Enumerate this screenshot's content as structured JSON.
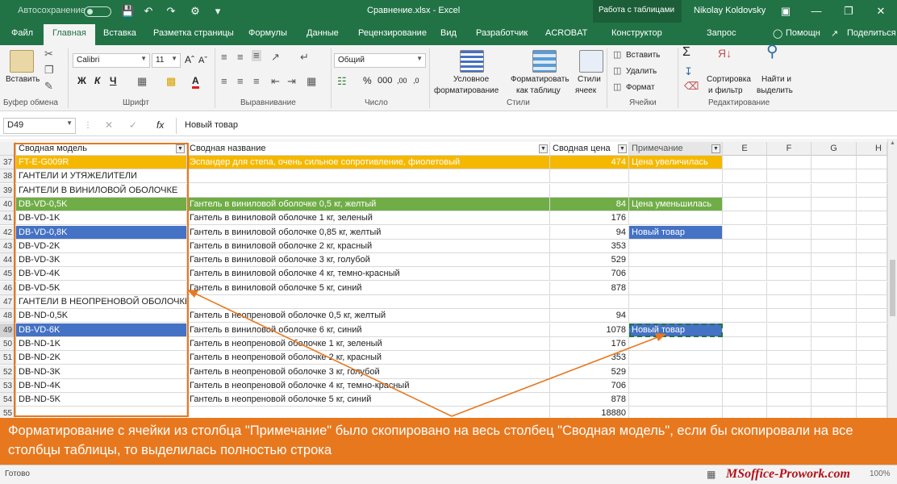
{
  "titlebar": {
    "autosave": "Автосохранение",
    "toggle_state": "Откл.",
    "filename": "Сравнение.xlsx - Excel",
    "context": "Работа с таблицами",
    "user": "Nikolay Koldovsky"
  },
  "tabs": [
    "Файл",
    "Главная",
    "Вставка",
    "Разметка страницы",
    "Формулы",
    "Данные",
    "Рецензирование",
    "Вид",
    "Разработчик",
    "ACROBAT",
    "Конструктор",
    "Запрос"
  ],
  "tabs_right": {
    "help": "Помощн",
    "share": "Поделиться"
  },
  "ribbon": {
    "paste": "Вставить",
    "clipboard": "Буфер обмена",
    "font_name": "Calibri",
    "font_size": "11",
    "bold": "Ж",
    "italic": "К",
    "underline": "Ч",
    "font": "Шрифт",
    "alignment": "Выравнивание",
    "number_format": "Общий",
    "number": "Число",
    "cond_format": [
      "Условное",
      "форматирование"
    ],
    "format_table": [
      "Форматировать",
      "как таблицу"
    ],
    "cell_styles": [
      "Стили",
      "ячеек"
    ],
    "styles": "Стили",
    "insert": "Вставить",
    "delete": "Удалить",
    "format": "Формат",
    "cells": "Ячейки",
    "sort": [
      "Сортировка",
      "и фильтр"
    ],
    "find": [
      "Найти и",
      "выделить"
    ],
    "editing": "Редактирование"
  },
  "formula_bar": {
    "name_box": "D49",
    "fx": "fx",
    "value": "Новый товар"
  },
  "columns": [
    "Сводная модель",
    "Сводная название",
    "Сводная цена",
    "Примечание",
    "E",
    "F",
    "G",
    "H"
  ],
  "rows": [
    {
      "n": "37",
      "a": "FT-E-G009R",
      "b": "Эспандер для степа, очень сильное сопротивление, фиолетовый",
      "c": "474",
      "d": "Цена увеличилась",
      "style": "orange"
    },
    {
      "n": "38",
      "a": "ГАНТЕЛИ И УТЯЖЕЛИТЕЛИ",
      "b": "",
      "c": "",
      "d": "",
      "style": ""
    },
    {
      "n": "39",
      "a": "ГАНТЕЛИ  В ВИНИЛОВОЙ ОБОЛОЧКЕ",
      "b": "",
      "c": "",
      "d": "",
      "style": ""
    },
    {
      "n": "40",
      "a": "DB-VD-0,5K",
      "b": "Гантель в виниловой оболочке 0,5 кг, желтый",
      "c": "84",
      "d": "Цена уменьшилась",
      "style": "green"
    },
    {
      "n": "41",
      "a": "DB-VD-1K",
      "b": "Гантель в виниловой оболочке 1 кг, зеленый",
      "c": "176",
      "d": "",
      "style": ""
    },
    {
      "n": "42",
      "a": "DB-VD-0,8K",
      "b": "Гантель в виниловой оболочке 0,85 кг, желтый",
      "c": "94",
      "d": "Новый товар",
      "style": "blue"
    },
    {
      "n": "43",
      "a": "DB-VD-2K",
      "b": "Гантель в виниловой оболочке 2 кг, красный",
      "c": "353",
      "d": "",
      "style": ""
    },
    {
      "n": "44",
      "a": "DB-VD-3K",
      "b": "Гантель в виниловой оболочке 3 кг, голубой",
      "c": "529",
      "d": "",
      "style": ""
    },
    {
      "n": "45",
      "a": "DB-VD-4K",
      "b": "Гантель в виниловой оболочке 4 кг, темно-красный",
      "c": "706",
      "d": "",
      "style": ""
    },
    {
      "n": "46",
      "a": "DB-VD-5K",
      "b": "Гантель в виниловой оболочке 5 кг, синий",
      "c": "878",
      "d": "",
      "style": ""
    },
    {
      "n": "47",
      "a": "ГАНТЕЛИ  В НЕОПРЕНОВОЙ ОБОЛОЧКЕ",
      "b": "",
      "c": "",
      "d": "",
      "style": ""
    },
    {
      "n": "48",
      "a": "DB-ND-0,5K",
      "b": "Гантель в неопреновой оболочке 0,5 кг, желтый",
      "c": "94",
      "d": "",
      "style": ""
    },
    {
      "n": "49",
      "a": "DB-VD-6K",
      "b": "Гантель в виниловой оболочке 6 кг, синий",
      "c": "1078",
      "d": "Новый товар",
      "style": "blue-sel"
    },
    {
      "n": "50",
      "a": "DB-ND-1K",
      "b": "Гантель в неопреновой оболочке 1 кг, зеленый",
      "c": "176",
      "d": "",
      "style": ""
    },
    {
      "n": "51",
      "a": "DB-ND-2K",
      "b": "Гантель в неопреновой оболочке 2 кг, красный",
      "c": "353",
      "d": "",
      "style": ""
    },
    {
      "n": "52",
      "a": "DB-ND-3K",
      "b": "Гантель в неопреновой оболочке 3 кг, голубой",
      "c": "529",
      "d": "",
      "style": ""
    },
    {
      "n": "53",
      "a": "DB-ND-4K",
      "b": "Гантель в неопреновой оболочке 4 кг, темно-красный",
      "c": "706",
      "d": "",
      "style": ""
    },
    {
      "n": "54",
      "a": "DB-ND-5K",
      "b": "Гантель в неопреновой оболочке 5 кг, синий",
      "c": "878",
      "d": "",
      "style": ""
    },
    {
      "n": "55",
      "a": "",
      "b": "",
      "c": "18880",
      "d": "",
      "style": ""
    }
  ],
  "annotation": "Форматирование с ячейки из столбца \"Примечание\" было скопировано на весь столбец \"Сводная модель\", если бы скопировали на все столбцы таблицы, то выделилась полностью строка",
  "status": {
    "ready": "Готово",
    "zoom": "100%",
    "watermark": "MSoffice-Prowork.com"
  },
  "colors": {
    "excel_green": "#217346",
    "orange_row": "#f5b800",
    "green_row": "#70ad47",
    "blue_row": "#4472c4",
    "annotation": "#e8781e"
  },
  "icons": [
    "save-icon",
    "undo-icon",
    "redo-icon",
    "paste-icon",
    "cut-icon",
    "copy-icon",
    "format-painter-icon",
    "sum-icon",
    "sort-icon",
    "find-icon",
    "help-icon",
    "share-icon"
  ]
}
